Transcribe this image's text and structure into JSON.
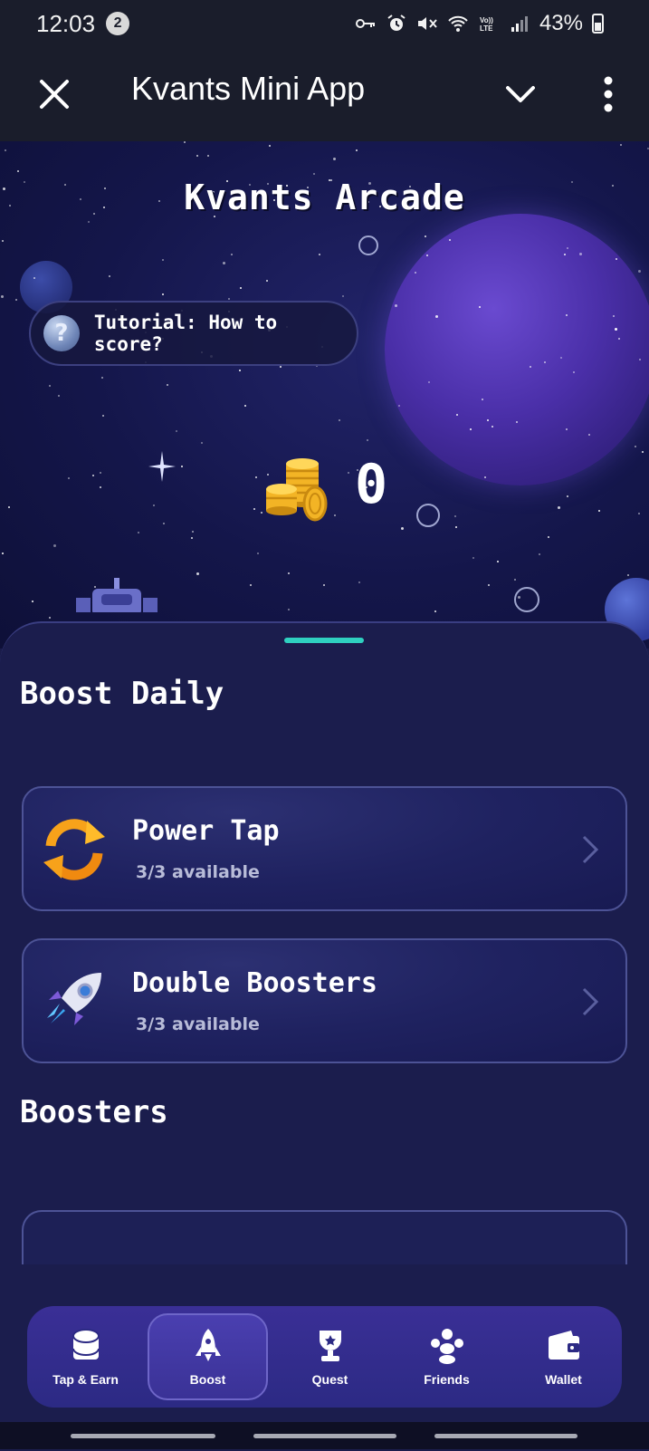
{
  "status_bar": {
    "time": "12:03",
    "notification_count": "2",
    "battery": "43%",
    "icons": [
      "key-icon",
      "alarm-icon",
      "mute-icon",
      "wifi-icon",
      "volte-icon",
      "signal-icon",
      "battery-icon"
    ]
  },
  "app_bar": {
    "title": "Kvants Mini App"
  },
  "hero": {
    "title": "Kvants Arcade",
    "tutorial_label": "Tutorial: How to score?",
    "tutorial_icon": "?",
    "score": "0"
  },
  "boost_daily": {
    "title": "Boost Daily",
    "items": [
      {
        "title": "Power Tap",
        "subtitle": "3/3 available",
        "icon": "refresh-arrows-icon"
      },
      {
        "title": "Double Boosters",
        "subtitle": "3/3 available",
        "icon": "rocket-icon"
      }
    ]
  },
  "boosters": {
    "title": "Boosters"
  },
  "nav": {
    "items": [
      {
        "label": "Tap & Earn",
        "icon": "coin-stack-icon",
        "active": false
      },
      {
        "label": "Boost",
        "icon": "rocket-icon",
        "active": true
      },
      {
        "label": "Quest",
        "icon": "trophy-icon",
        "active": false
      },
      {
        "label": "Friends",
        "icon": "friends-icon",
        "active": false
      },
      {
        "label": "Wallet",
        "icon": "wallet-icon",
        "active": false
      }
    ]
  },
  "colors": {
    "accent_teal": "#2fd0c0",
    "nav_bg": "#3a2f96",
    "sheet_bg": "#1b1d4d"
  }
}
